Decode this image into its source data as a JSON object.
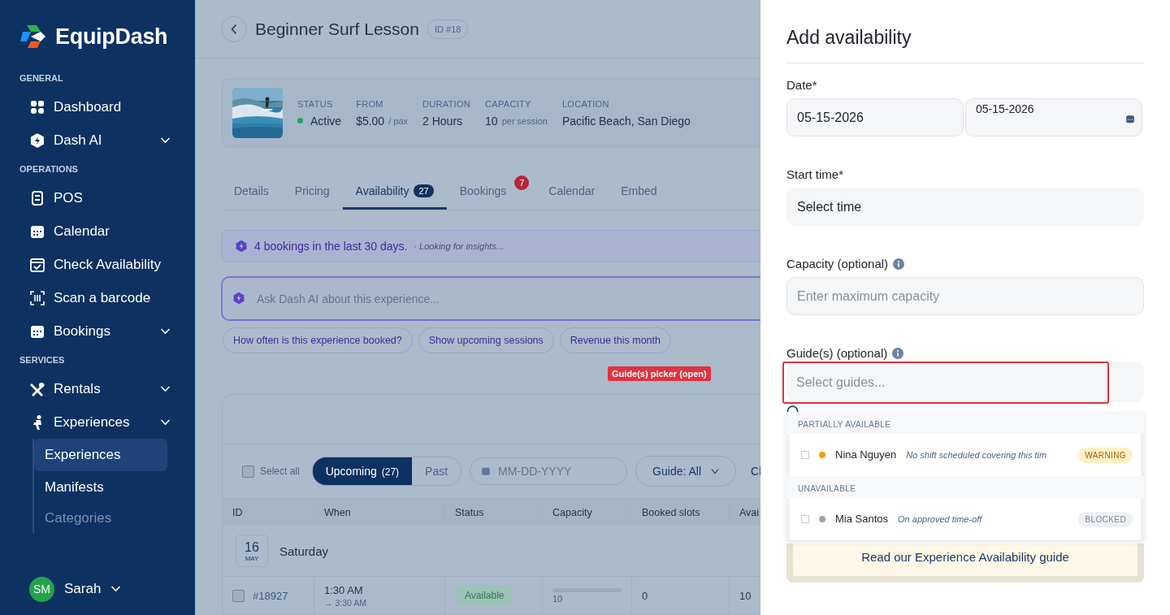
{
  "sidebar": {
    "logo": "EquipDash",
    "sections": [
      {
        "title": "GENERAL",
        "items": [
          {
            "label": "Dashboard",
            "expandable": false
          },
          {
            "label": "Dash AI",
            "expandable": true
          }
        ]
      },
      {
        "title": "OPERATIONS",
        "items": [
          {
            "label": "POS",
            "expandable": false
          },
          {
            "label": "Calendar",
            "expandable": false
          },
          {
            "label": "Check Availability",
            "expandable": false
          },
          {
            "label": "Scan a barcode",
            "expandable": false
          },
          {
            "label": "Bookings",
            "expandable": true
          }
        ]
      },
      {
        "title": "SERVICES",
        "items": [
          {
            "label": "Rentals",
            "expandable": true
          },
          {
            "label": "Experiences",
            "expandable": true,
            "children": [
              {
                "label": "Experiences",
                "selected": true
              },
              {
                "label": "Manifests",
                "selected": false
              },
              {
                "label": "Categories",
                "selected": false
              }
            ]
          }
        ]
      }
    ],
    "user": {
      "initials": "SM",
      "name": "Sarah"
    }
  },
  "header": {
    "title": "Beginner Surf Lesson",
    "id_badge": "ID #18"
  },
  "summary": {
    "stats": [
      {
        "label": "STATUS",
        "value": "Active",
        "kind": "status"
      },
      {
        "label": "FROM",
        "value": "$5.00",
        "unit": "/ pax"
      },
      {
        "label": "DURATION",
        "value": "2 Hours"
      },
      {
        "label": "CAPACITY",
        "value": "10",
        "unit": "per session"
      },
      {
        "label": "LOCATION",
        "value": "Pacific Beach, San Diego"
      }
    ]
  },
  "tabs": [
    {
      "label": "Details",
      "selected": false
    },
    {
      "label": "Pricing",
      "selected": false
    },
    {
      "label": "Availability",
      "selected": true,
      "count": "27"
    },
    {
      "label": "Bookings",
      "selected": false,
      "badge": "7"
    },
    {
      "label": "Calendar",
      "selected": false
    },
    {
      "label": "Embed",
      "selected": false
    }
  ],
  "insight": {
    "text": "4 bookings in the last 30 days.",
    "note": "· Looking for insights..."
  },
  "ask_field": {
    "placeholder": "Ask Dash AI about this experience..."
  },
  "suggestions": [
    "How often is this experience booked?",
    "Show upcoming sessions",
    "Revenue this month"
  ],
  "annotation_tag": "Guide(s) picker (open)",
  "table": {
    "toolbar": {
      "select_all": {
        "label": "Select all",
        "checked": false
      },
      "segments": [
        {
          "label": "Upcoming",
          "count": "(27)",
          "selected": true
        },
        {
          "label": "Past",
          "selected": false
        }
      ],
      "date_field": {
        "placeholder": "MM-DD-YYYY"
      },
      "guide_filter": "Guide: All",
      "cut_button": "Cl"
    },
    "columns": [
      "ID",
      "When",
      "Status",
      "Capacity",
      "Booked slots",
      "Avai"
    ],
    "groups": [
      {
        "day": "16",
        "month": "MAY",
        "weekday": "Saturday",
        "rows": [
          {
            "checked": false,
            "id": "#18927",
            "start": "1:30 AM",
            "end": "→ 3:30 AM",
            "status": "Available",
            "capacity": "10",
            "level": 0,
            "booked": "0",
            "available": "10"
          }
        ]
      }
    ]
  },
  "panel": {
    "title": "Add availability",
    "date": {
      "label": "Date*",
      "value": "05-15-2026",
      "picker_value": "05-15-2026"
    },
    "start_time": {
      "label": "Start time*",
      "value": "Select time"
    },
    "capacity": {
      "label": "Capacity (optional)",
      "placeholder": "Enter maximum capacity"
    },
    "guides": {
      "label": "Guide(s) (optional)",
      "placeholder": "Select guides...",
      "highlighted": true,
      "groups": [
        {
          "title": "PARTIALLY AVAILABLE",
          "options": [
            {
              "name": "Nina Nguyen",
              "checked": false,
              "color": "#f59e0b",
              "note": "No shift scheduled covering this tim",
              "tag": "WARNING",
              "kind": "warning"
            }
          ]
        },
        {
          "title": "UNAVAILABLE",
          "options": [
            {
              "name": "Mia Santos",
              "checked": false,
              "color": "#9ca3af",
              "note": "On approved time-off",
              "tag": "BLOCKED",
              "kind": "blocked"
            }
          ]
        }
      ]
    },
    "guide_link": "Read our Experience Availability guide"
  }
}
